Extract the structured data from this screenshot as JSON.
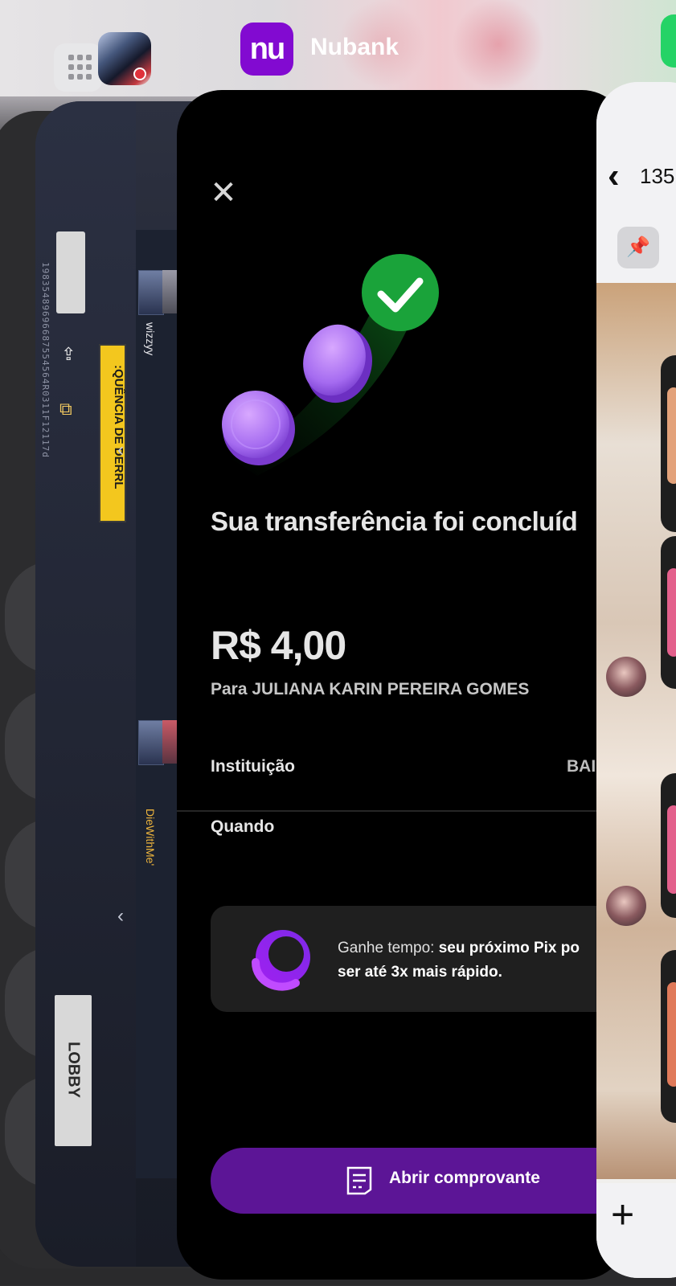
{
  "switcher": {
    "active_app_name": "Nubank",
    "nubank_icon_text": "nu",
    "apps": [
      "calculator-icon",
      "free-fire-icon",
      "nubank-icon",
      "whatsapp-icon"
    ]
  },
  "game_card": {
    "vertical_code": "19835489696687554564R0311F12117d",
    "banner_text": ":QUÊNCIA DE DERRL",
    "players": [
      "wizzyy",
      "DieWithMe'"
    ],
    "lobby_label": "LOBBY"
  },
  "nubank": {
    "close_icon": "close-icon",
    "title": "Sua transferência foi concluíd",
    "amount": "R$ 4,00",
    "recipient": "Para JULIANA KARIN PEREIRA GOMES",
    "details": [
      {
        "label": "Instituição",
        "value": "BAI"
      },
      {
        "label": "Quando",
        "value": ""
      }
    ],
    "promo": {
      "text_prefix": "Ganhe tempo: ",
      "text_bold": "seu próximo Pix po",
      "text_bold_line2": "ser até 3x mais rápido."
    },
    "cta_label": "Abrir comprovante",
    "colors": {
      "brand": "#820ad1",
      "cta": "#5c1596",
      "success": "#1aa33a"
    }
  },
  "chat_card": {
    "header_number": "135"
  }
}
